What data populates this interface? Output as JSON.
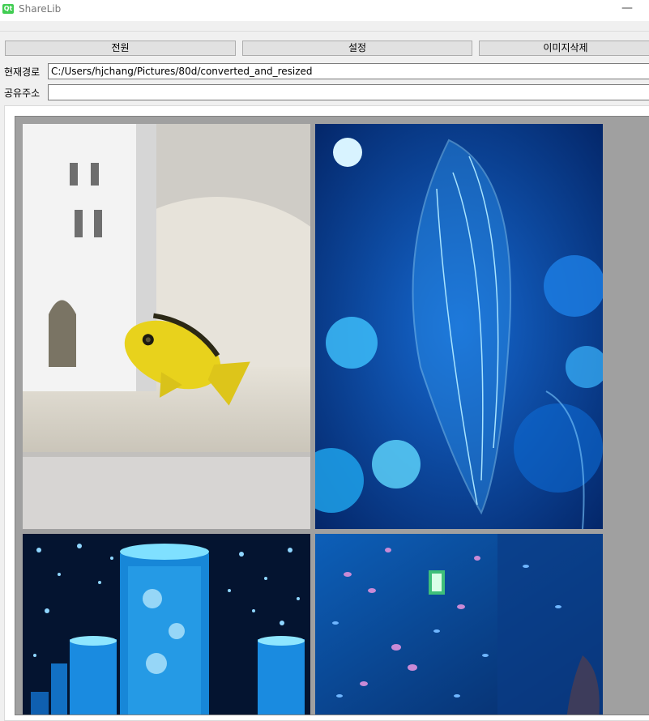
{
  "window": {
    "title": "ShareLib",
    "app_icon": "qt-icon",
    "minimize_label": "—"
  },
  "toolbar": {
    "power_label": "전원",
    "settings_label": "설정",
    "delete_label": "이미지삭제"
  },
  "path": {
    "label": "현재경로",
    "value": "C:/Users/hjchang/Pictures/80d/converted_and_resized"
  },
  "share": {
    "label": "공유주소",
    "value": ""
  },
  "gallery": {
    "images": [
      {
        "subject": "yellow cichlid fish in aquarium"
      },
      {
        "subject": "glowing blue jellyfish"
      },
      {
        "subject": "illuminated jellyfish tanks"
      },
      {
        "subject": "underwater aquarium with fish"
      }
    ]
  }
}
